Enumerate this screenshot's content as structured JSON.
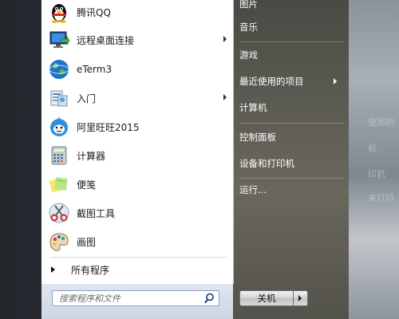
{
  "programs": [
    {
      "name": "tencent-qq",
      "label": "腾讯QQ",
      "icon": "penguin-icon",
      "submenu": false
    },
    {
      "name": "remote-desktop",
      "label": "远程桌面连接",
      "icon": "remote-desktop-icon",
      "submenu": true
    },
    {
      "name": "eterm3",
      "label": "eTerm3",
      "icon": "globe-icon",
      "submenu": false
    },
    {
      "name": "getting-started",
      "label": "入门",
      "icon": "getting-started-icon",
      "submenu": true
    },
    {
      "name": "aliwangwang",
      "label": "阿里旺旺2015",
      "icon": "wangwang-icon",
      "submenu": false
    },
    {
      "name": "calculator",
      "label": "计算器",
      "icon": "calculator-icon",
      "submenu": false
    },
    {
      "name": "sticky-notes",
      "label": "便笺",
      "icon": "sticky-notes-icon",
      "submenu": false
    },
    {
      "name": "snipping-tool",
      "label": "截图工具",
      "icon": "scissors-icon",
      "submenu": false
    },
    {
      "name": "paint",
      "label": "画图",
      "icon": "paint-palette-icon",
      "submenu": false
    }
  ],
  "all_programs": "所有程序",
  "search": {
    "placeholder": "搜索程序和文件"
  },
  "right_items": [
    {
      "name": "pictures",
      "label": "图片",
      "submenu": false
    },
    {
      "name": "music",
      "label": "音乐",
      "submenu": false
    },
    {
      "name": "games",
      "label": "游戏",
      "submenu": false
    },
    {
      "name": "recent-items",
      "label": "最近使用的项目",
      "submenu": true
    },
    {
      "name": "computer",
      "label": "计算机",
      "submenu": false
    },
    {
      "name": "control-panel",
      "label": "控制面板",
      "submenu": false
    },
    {
      "name": "devices-printers",
      "label": "设备和打印机",
      "submenu": false
    },
    {
      "name": "run",
      "label": "运行...",
      "submenu": false
    }
  ],
  "shutdown": {
    "label": "关机"
  },
  "desktop_ghost_text": [
    "使用的",
    "机",
    "印机",
    "末打印"
  ]
}
